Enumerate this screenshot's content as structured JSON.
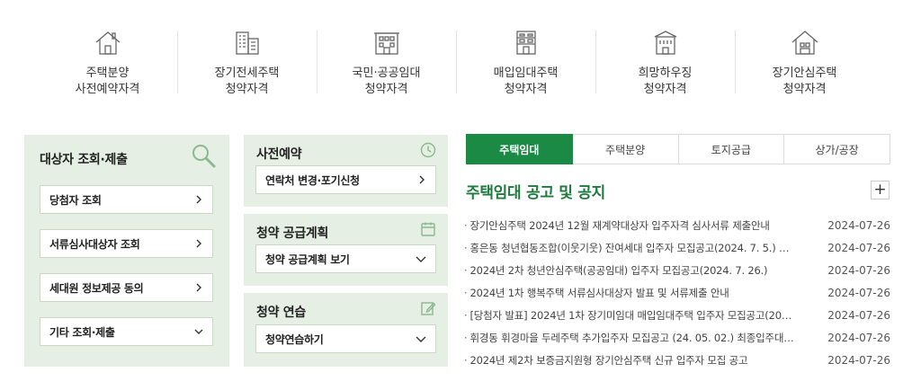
{
  "quick_menu": [
    {
      "line1": "주택분양",
      "line2": "사전예약자격",
      "icon": "house-icon"
    },
    {
      "line1": "장기전세주택",
      "line2": "청약자격",
      "icon": "apartment-icon"
    },
    {
      "line1": "국민·공공임대",
      "line2": "청약자격",
      "icon": "building-icon"
    },
    {
      "line1": "매입임대주택",
      "line2": "청약자격",
      "icon": "office-building-icon"
    },
    {
      "line1": "희망하우징",
      "line2": "청약자격",
      "icon": "dormitory-icon"
    },
    {
      "line1": "장기안심주택",
      "line2": "청약자격",
      "icon": "secure-house-icon"
    }
  ],
  "left_panel": {
    "title": "대상자 조회·제출",
    "buttons": [
      "당첨자 조회",
      "서류심사대상자 조회",
      "세대원 정보제공 동의",
      "기타 조회·제출"
    ]
  },
  "reservation": {
    "title": "사전예약",
    "button": "연락처 변경·포기신청"
  },
  "supply_plan": {
    "title": "청약 공급계획",
    "button": "청약 공급계획 보기"
  },
  "practice": {
    "title": "청약 연습",
    "button": "청약연습하기"
  },
  "notice": {
    "tabs": [
      "주택임대",
      "주택분양",
      "토지공급",
      "상가/공장"
    ],
    "active_tab": 0,
    "title": "주택임대 공고 및 공지",
    "more_label": "+",
    "items": [
      {
        "text": "장기안심주택 2024년 12월 재계약대상자 입주자격 심사서류 제출안내",
        "date": "2024-07-26"
      },
      {
        "text": "홍은동 청년협동조합(이웃기웃) 잔여세대 입주자 모집공고(2024. 7. 5.) …",
        "date": "2024-07-26"
      },
      {
        "text": "2024년 2차 청년안심주택(공공임대) 입주자 모집공고(2024. 7. 26.)",
        "date": "2024-07-26"
      },
      {
        "text": "2024년 1차 행복주택 서류심사대상자 발표 및 서류제출 안내",
        "date": "2024-07-26"
      },
      {
        "text": "[당첨자 발표] 2024년 1차 장기미임대 매입임대주택 입주자 모집공고(20…",
        "date": "2024-07-26"
      },
      {
        "text": "휘경동 휘경마을 두레주택 추가입주자 모집공고 (24. 05. 02.) 최종입주대…",
        "date": "2024-07-26"
      },
      {
        "text": "2024년 제2차 보증금지원형 장기안심주택 신규 입주자 모집 공고",
        "date": "2024-07-26"
      }
    ]
  },
  "colors": {
    "accent": "#1a8a45",
    "panel_bg": "#e5efe4",
    "title_green": "#1e7a3d"
  }
}
